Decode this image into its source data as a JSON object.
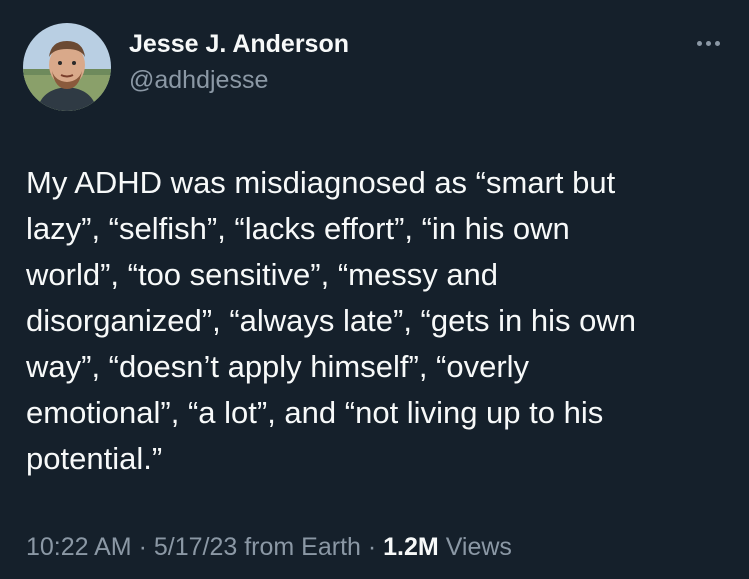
{
  "author": {
    "display_name": "Jesse J. Anderson",
    "handle": "@adhdjesse",
    "avatar_icon": "profile-photo"
  },
  "menu": {
    "icon": "more-options-icon"
  },
  "tweet": {
    "lines": [
      "My ADHD was misdiagnosed as “smart but",
      "lazy”, “selfish”, “lacks effort”, “in his own",
      "world”, “too sensitive”, “messy and",
      "disorganized”, “always late”, “gets in his own",
      "way”, “doesn’t apply himself”, “overly",
      "emotional”, “a lot”, and “not living up to his",
      "potential.”"
    ]
  },
  "meta": {
    "time": "10:22 AM",
    "sep1": " · ",
    "date": "5/17/23",
    "source": " from Earth",
    "sep2": " · ",
    "views_count": "1.2M",
    "views_label": " Views"
  },
  "colors": {
    "background": "#15202b",
    "primary_text": "#f7f9f9",
    "secondary_text": "#8b98a5"
  }
}
